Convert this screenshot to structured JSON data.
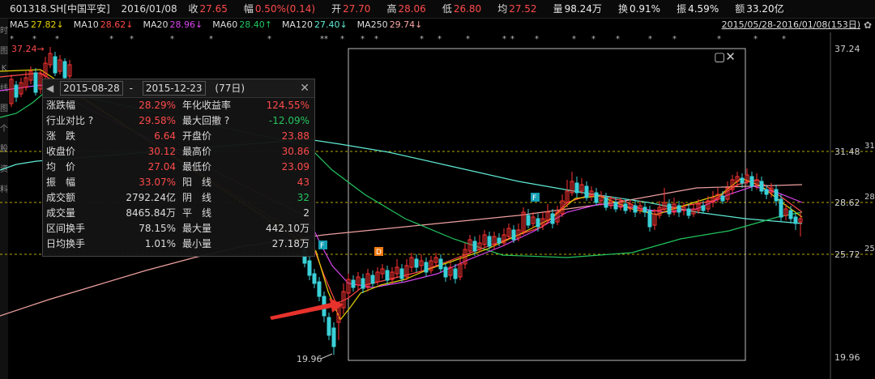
{
  "header": {
    "symbol": "601318.SH[中国平安]",
    "date": "2016/01/08",
    "fields": [
      {
        "label": "收",
        "value": "27.65",
        "color": "red"
      },
      {
        "label": "幅",
        "value": "0.50%(0.14)",
        "color": "red"
      },
      {
        "label": "开",
        "value": "27.70",
        "color": "red"
      },
      {
        "label": "高",
        "value": "28.06",
        "color": "red"
      },
      {
        "label": "低",
        "value": "26.80",
        "color": "red"
      },
      {
        "label": "均",
        "value": "27.52",
        "color": "red"
      },
      {
        "label": "量",
        "value": "98.24万",
        "color": "white"
      },
      {
        "label": "换",
        "value": "0.91%",
        "color": "white"
      },
      {
        "label": "振",
        "value": "4.59%",
        "color": "white"
      },
      {
        "label": "额",
        "value": "33.20亿",
        "color": "white"
      }
    ]
  },
  "ma_bar": {
    "items": [
      {
        "label": "MA5",
        "value": "27.82↓",
        "color": "#e5d300"
      },
      {
        "label": "MA10",
        "value": "28.62↓",
        "color": "#ff4a4a"
      },
      {
        "label": "MA20",
        "value": "28.96↓",
        "color": "#d946ef"
      },
      {
        "label": "MA60",
        "value": "28.40↑",
        "color": "#22c55e"
      },
      {
        "label": "MA120",
        "value": "27.40↓",
        "color": "#5eead4"
      },
      {
        "label": "MA250",
        "value": "29.74↓",
        "color": "#fca5a5"
      }
    ],
    "range": "2015/05/28-2016/01/08(153日)",
    "gear_icon": "gear-icon"
  },
  "axis": {
    "ticks": [
      "37.24",
      "31.48",
      "28.62",
      "25.72",
      "19.96"
    ],
    "edge_labels": [
      "31.48",
      "28.6",
      "25.7"
    ],
    "high_label": "37.24",
    "low_label": "19.96"
  },
  "markers": [
    "F",
    "D",
    "F"
  ],
  "stats": {
    "start_date": "2015-08-28",
    "end_date": "2015-12-23",
    "days": "(77日)",
    "rows": [
      {
        "k1": "涨跌幅",
        "v1": "28.29%",
        "c1": "#ff4a4a",
        "k2": "年化收益率",
        "v2": "124.55%",
        "c2": "#ff4a4a"
      },
      {
        "k1": "行业对比 ?",
        "v1": "29.58%",
        "c1": "#ff4a4a",
        "k2": "最大回撤 ?",
        "v2": "-12.09%",
        "c2": "#22c55e"
      },
      {
        "k1": "涨　跌",
        "v1": "6.64",
        "c1": "#ff4a4a",
        "k2": "开盘价",
        "v2": "23.88",
        "c2": "#ff4a4a"
      },
      {
        "k1": "收盘价",
        "v1": "30.12",
        "c1": "#ff4a4a",
        "k2": "最高价",
        "v2": "30.86",
        "c2": "#ff4a4a"
      },
      {
        "k1": "均　价",
        "v1": "27.04",
        "c1": "#ff4a4a",
        "k2": "最低价",
        "v2": "23.09",
        "c2": "#ff4a4a"
      },
      {
        "k1": "振　幅",
        "v1": "33.07%",
        "c1": "#ff4a4a",
        "k2": "阳　线",
        "v2": "43",
        "c2": "#ff4a4a"
      },
      {
        "k1": "成交额",
        "v1": "2792.24亿",
        "c1": "#ddd",
        "k2": "阴　线",
        "v2": "32",
        "c2": "#22c55e"
      },
      {
        "k1": "成交量",
        "v1": "8465.84万",
        "c1": "#ddd",
        "k2": "平　线",
        "v2": "2",
        "c2": "#ddd"
      },
      {
        "k1": "区间换手",
        "v1": "78.15%",
        "c1": "#ddd",
        "k2": "最大量",
        "v2": "442.10万",
        "c2": "#ddd"
      },
      {
        "k1": "日均换手",
        "v1": "1.01%",
        "c1": "#ddd",
        "k2": "最小量",
        "v2": "27.18万",
        "c2": "#ddd"
      }
    ]
  },
  "left_strip": [
    "分",
    "时",
    "图",
    "K",
    "线",
    "图",
    "个",
    "股",
    "资",
    "料"
  ]
}
